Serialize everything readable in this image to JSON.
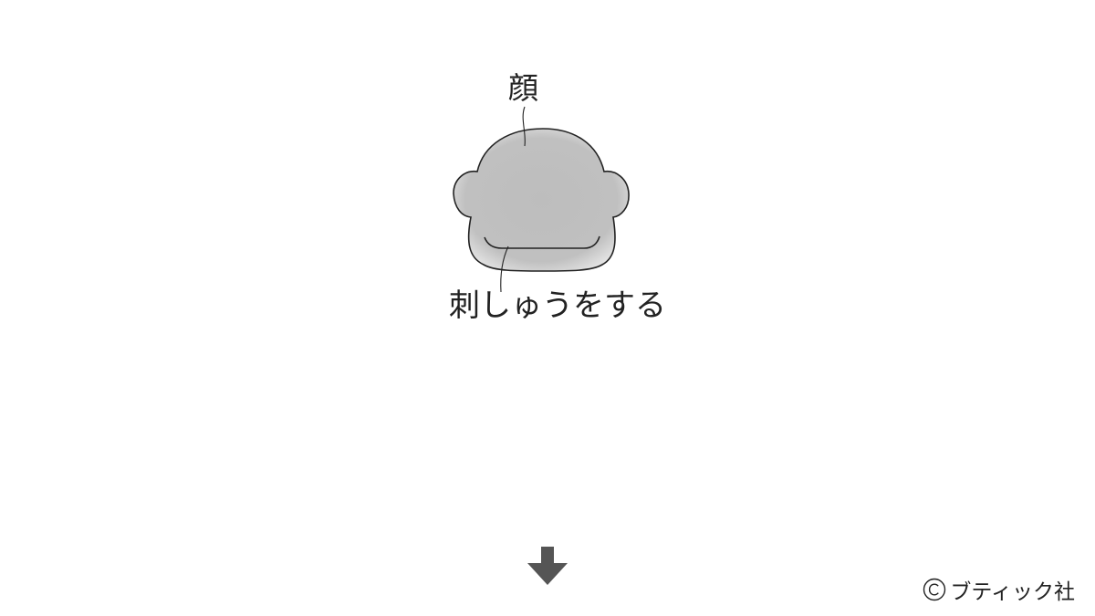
{
  "labels": {
    "face": "顔",
    "embroider": "刺しゅうをする"
  },
  "copyright": {
    "text": "ブティック社"
  },
  "colors": {
    "face_fill": "#bdbdbd",
    "face_edge": "#f2f2f2",
    "outline": "#222222",
    "arrow": "#555555"
  },
  "icons": {
    "arrow": "down-arrow-icon",
    "copyright": "copyright-icon"
  }
}
